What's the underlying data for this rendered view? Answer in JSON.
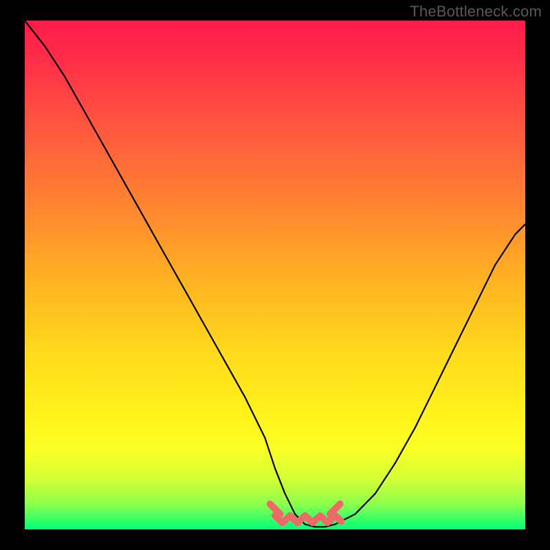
{
  "watermark": "TheBottleneck.com",
  "chart_data": {
    "type": "line",
    "title": "",
    "xlabel": "",
    "ylabel": "",
    "xlim": [
      0,
      100
    ],
    "ylim": [
      0,
      100
    ],
    "grid": false,
    "legend": null,
    "annotations": [],
    "series": [
      {
        "name": "bottleneck-curve",
        "x": [
          0,
          4,
          8,
          12,
          16,
          20,
          24,
          28,
          32,
          36,
          40,
          44,
          48,
          50,
          52,
          54,
          56,
          58,
          60,
          62,
          66,
          70,
          74,
          78,
          82,
          86,
          90,
          94,
          98,
          100
        ],
        "values": [
          100,
          95,
          89,
          82,
          75,
          68,
          61,
          54,
          47,
          40,
          33,
          26,
          18,
          12,
          7,
          3,
          1,
          0.5,
          0.5,
          1,
          3,
          7,
          13,
          20,
          28,
          36,
          44,
          52,
          58,
          60
        ]
      }
    ],
    "background_gradient": {
      "top": "#ff1b4a",
      "mid1": "#ff8a2f",
      "mid2": "#ffd91d",
      "near_bottom": "#d4ff35",
      "bottom": "#00ff7a"
    },
    "coral_band": {
      "color": "#ed6a66",
      "x_range": [
        50,
        62
      ],
      "value": 2
    }
  }
}
